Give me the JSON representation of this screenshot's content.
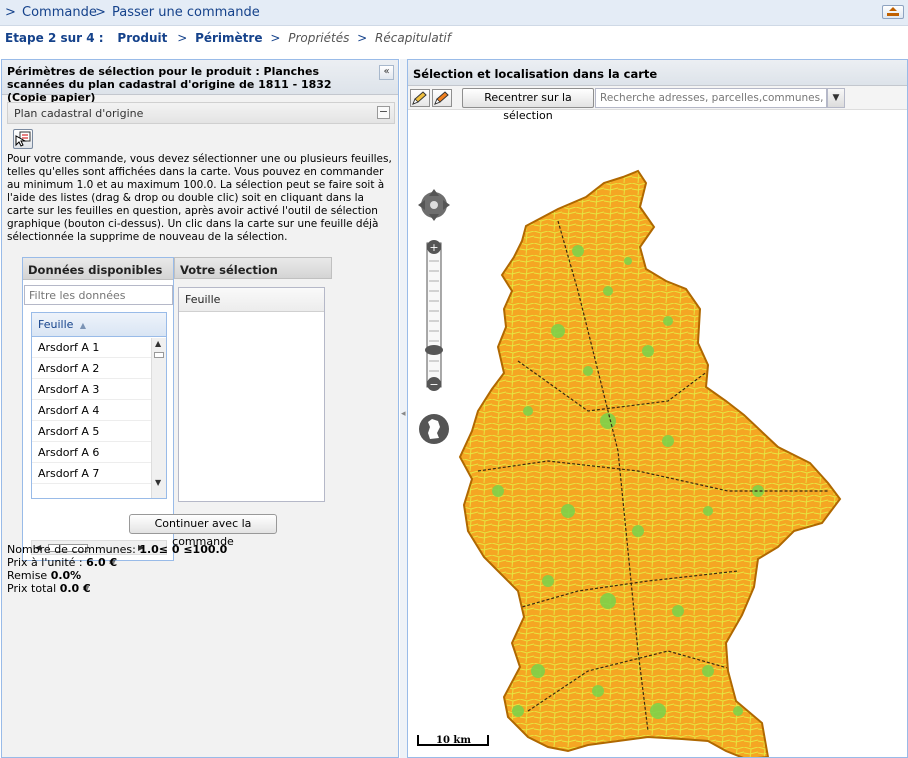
{
  "topbar": {
    "crumbs": [
      "Commande",
      "Passer une commande"
    ],
    "separator": ">"
  },
  "steps": {
    "prefix": "Etape 2 sur 4 :",
    "items": [
      {
        "label": "Produit",
        "state": "done"
      },
      {
        "label": "Périmètre",
        "state": "current"
      },
      {
        "label": "Propriétés",
        "state": "todo"
      },
      {
        "label": "Récapitulatif",
        "state": "todo"
      }
    ],
    "arrow": ">"
  },
  "left": {
    "title": "Périmètres de sélection pour le produit : Planches scannées du plan cadastral d'origine de 1811 - 1832 (Copie papier)",
    "collapse": "«",
    "section": "Plan cadastral d'origine",
    "section_toggle": "−",
    "intro": "Pour votre commande, vous devez sélectionner une ou plusieurs feuilles, telles qu'elles sont affichées dans la carte. Vous pouvez en commander au minimum 1.0 et au maximum 100.0. La sélection peut se faire soit à l'aide des listes (drag & drop ou double clic) soit en cliquant dans la carte sur les feuilles en question, après avoir activé l'outil de sélection graphique (bouton ci-dessus). Un clic dans la carte sur une feuille déjà sélectionnée la supprime de nouveau de la sélection.",
    "available": {
      "title": "Données disponibles",
      "filter_placeholder": "Filtre les données",
      "column": "Feuille",
      "rows": [
        "Arsdorf A 1",
        "Arsdorf A 2",
        "Arsdorf A 3",
        "Arsdorf A 4",
        "Arsdorf A 5",
        "Arsdorf A 6",
        "Arsdorf A 7"
      ]
    },
    "selection": {
      "title": "Votre sélection",
      "column": "Feuille"
    },
    "continue_button": "Continuer avec la commande",
    "summary": {
      "communes_label": "Nombre de communes:",
      "communes_value": "1.0≤ 0 ≤100.0",
      "unit_price_label": "Prix à l'unité :",
      "unit_price_value": "6.0 €",
      "discount_label": "Remise",
      "discount_value": "0.0%",
      "total_label": "Prix total",
      "total_value": "0.0 €"
    }
  },
  "right": {
    "title": "Sélection et localisation dans la carte",
    "recenter_button": "Recentrer sur la sélection",
    "search_placeholder": "Recherche adresses, parcelles,communes, loc",
    "scale_label": "10 km"
  },
  "icons": {
    "pan": "pan-arrows-icon",
    "zoom_in": "zoom-in-icon",
    "zoom_out": "zoom-out-icon",
    "max_extent": "country-outline-icon",
    "select_tool": "select-tool-icon",
    "exit": "exit-icon"
  },
  "colors": {
    "map_fill": "#f5a623",
    "map_lines": "#e0e030",
    "green_patches": "#7fd24a",
    "header_blue": "#15428b"
  }
}
